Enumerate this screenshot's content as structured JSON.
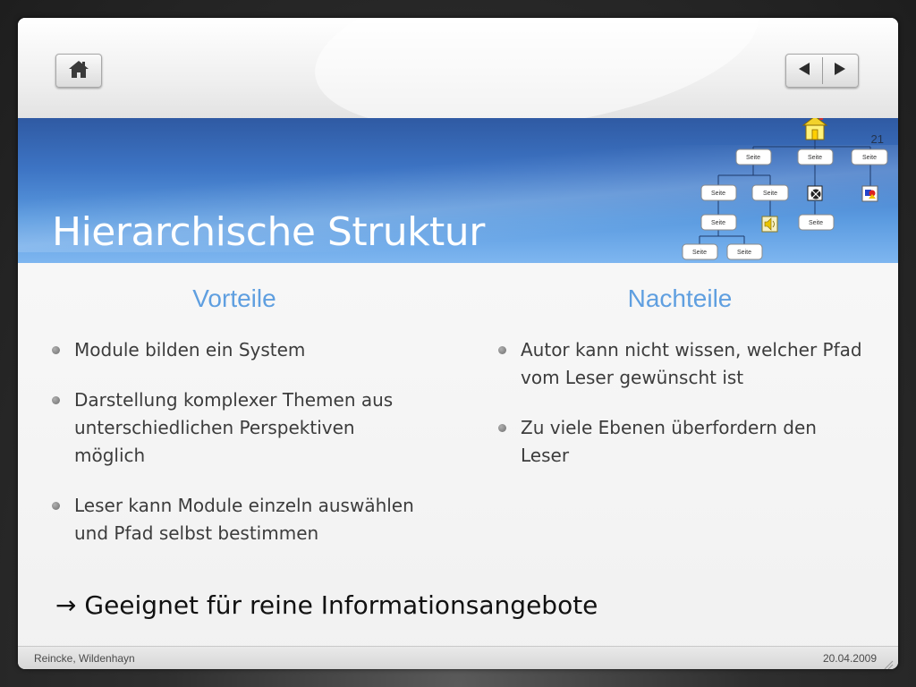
{
  "slide": {
    "title": "Hierarchische Struktur",
    "page_number": "21"
  },
  "nav": {
    "home_icon": "home-icon",
    "prev_icon": "triangle-left-icon",
    "next_icon": "triangle-right-icon"
  },
  "diagram": {
    "node_label": "Seite",
    "icons": [
      "house-icon",
      "film-reel-icon",
      "speaker-icon",
      "shapes-icon"
    ]
  },
  "columns": {
    "left": {
      "heading": "Vorteile",
      "items": [
        "Module bilden ein System",
        "Darstellung komplexer Themen aus unterschiedlichen Perspektiven möglich",
        "Leser kann Module einzeln auswählen und Pfad selbst bestimmen"
      ]
    },
    "right": {
      "heading": "Nachteile",
      "items": [
        "Autor kann nicht wissen, welcher Pfad vom Leser gewünscht ist",
        "Zu viele Ebenen überfordern den Leser"
      ]
    }
  },
  "conclusion": {
    "arrow": "→",
    "text": "Geeignet für reine Informationsangebote"
  },
  "footer": {
    "left": "Reincke, Wildenhayn",
    "right": "20.04.2009"
  },
  "colors": {
    "heading": "#5f9fe0",
    "band_dark": "#2f5aa3",
    "band_light": "#7eb6f0",
    "body_text": "#3c3c3c"
  }
}
